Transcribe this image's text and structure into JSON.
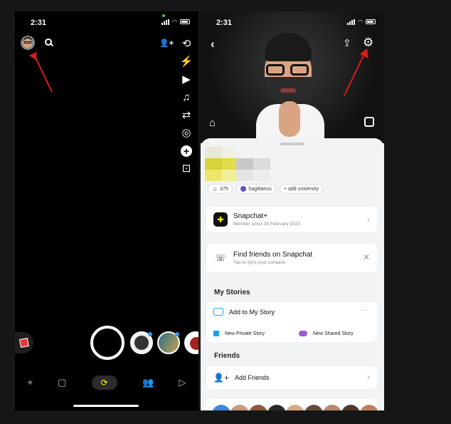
{
  "left_phone": {
    "status_time": "2:31",
    "icons": [
      "avatar",
      "search-icon",
      "add-friend-icon",
      "flip-camera-icon",
      "flash-icon",
      "video-icon",
      "music-icon",
      "dual-camera-icon",
      "lens-icon",
      "plus-icon",
      "scan-icon"
    ],
    "nav_icons": [
      "map-icon",
      "chat-icon",
      "camera-icon",
      "friends-icon",
      "stories-icon"
    ]
  },
  "right_phone": {
    "status_time": "2:31",
    "badges": {
      "score": "375",
      "zodiac": "Sagittarius",
      "add_university": "+ add university"
    },
    "snapchat_plus": {
      "title": "Snapchat+",
      "subtitle": "Member since 28 February 2023"
    },
    "find_friends": {
      "title": "Find friends on Snapchat",
      "subtitle": "Tap to sync your contacts"
    },
    "my_stories": {
      "heading": "My Stories",
      "add_to_story": "Add to My Story",
      "new_private": "New Private Story",
      "new_shared": "New Shared Story"
    },
    "friends": {
      "heading": "Friends",
      "add_friends": "Add Friends"
    }
  },
  "colors": {
    "snap_yellow": "#fffc00",
    "arrow_red": "#d81b1b",
    "accent_blue": "#1da1f2",
    "accent_purple": "#6b4ccf"
  }
}
